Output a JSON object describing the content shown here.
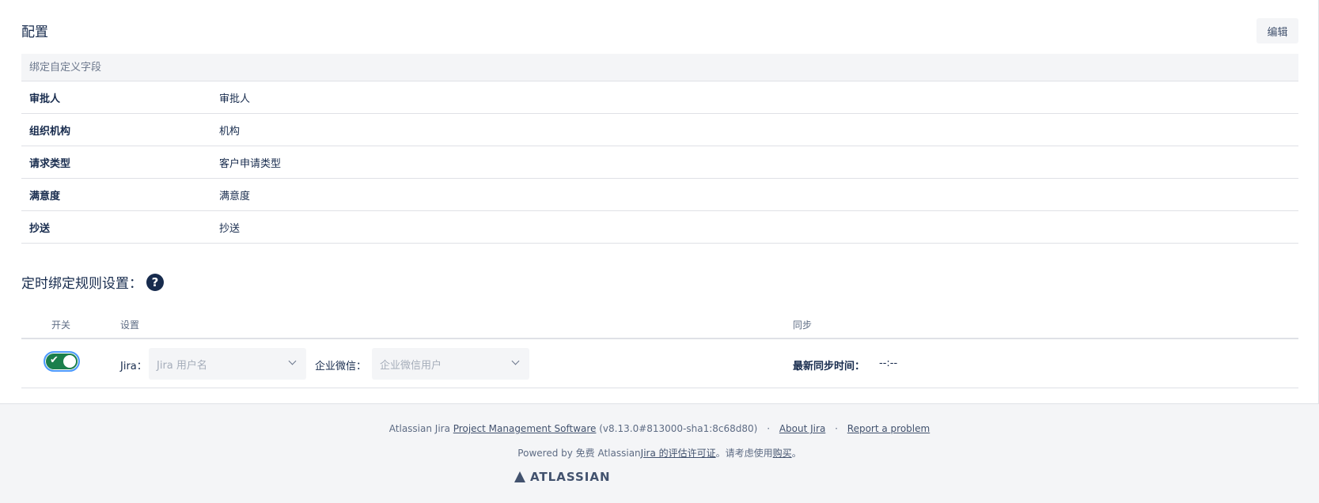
{
  "config": {
    "title": "配置",
    "edit_label": "编辑",
    "table_header": "绑定自定义字段",
    "rows": [
      {
        "key": "审批人",
        "value": "审批人"
      },
      {
        "key": "组织机构",
        "value": "机构"
      },
      {
        "key": "请求类型",
        "value": "客户申请类型"
      },
      {
        "key": "满意度",
        "value": "满意度"
      },
      {
        "key": "抄送",
        "value": "抄送"
      }
    ]
  },
  "rules": {
    "title": "定时绑定规则设置：",
    "help_icon": "question-circle-icon",
    "columns": {
      "switch": "开关",
      "settings": "设置",
      "sync": "同步"
    },
    "row": {
      "toggle_on": true,
      "jira_label": "Jira：",
      "jira_placeholder": "Jira 用户名",
      "wechat_label": "企业微信：",
      "wechat_placeholder": "企业微信用户",
      "sync_label": "最新同步时间：",
      "sync_value": "--:--"
    }
  },
  "footer": {
    "line1_prefix": "Atlassian Jira",
    "line1_link": "Project Management Software",
    "line1_version": "(v8.13.0#813000-sha1:8c68d80)",
    "about": "About Jira",
    "report": "Report a problem",
    "line2_prefix": "Powered by 免费 Atlassian",
    "line2_link": "Jira 的评估许可证",
    "line2_mid": "。请考虑使用",
    "line2_buy": "购买",
    "line2_end": "。",
    "logo_text": "ATLASSIAN"
  },
  "colors": {
    "toggle_on": "#1b7f4c",
    "text_primary": "#172b4d",
    "footer_bg": "#f4f5f7"
  }
}
